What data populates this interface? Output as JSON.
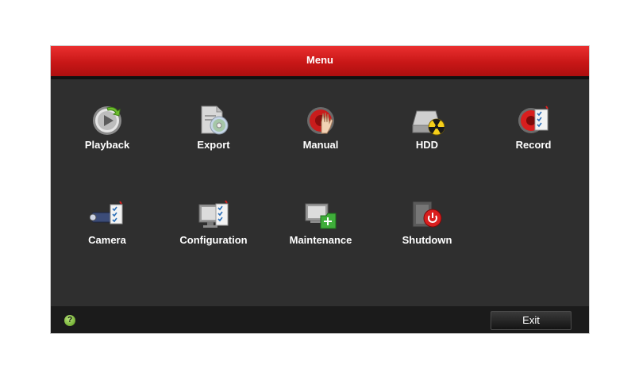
{
  "window": {
    "title": "Menu"
  },
  "menu": {
    "items": [
      {
        "label": "Playback",
        "icon": "playback-icon"
      },
      {
        "label": "Export",
        "icon": "export-icon"
      },
      {
        "label": "Manual",
        "icon": "manual-icon"
      },
      {
        "label": "HDD",
        "icon": "hdd-icon"
      },
      {
        "label": "Record",
        "icon": "record-icon"
      },
      {
        "label": "Camera",
        "icon": "camera-icon"
      },
      {
        "label": "Configuration",
        "icon": "configuration-icon"
      },
      {
        "label": "Maintenance",
        "icon": "maintenance-icon"
      },
      {
        "label": "Shutdown",
        "icon": "shutdown-icon"
      }
    ]
  },
  "footer": {
    "help_glyph": "?",
    "exit_label": "Exit"
  },
  "colors": {
    "title_bar": "#c81717",
    "panel": "#2f2f2f",
    "footer": "#1b1b1b",
    "text": "#ffffff"
  }
}
